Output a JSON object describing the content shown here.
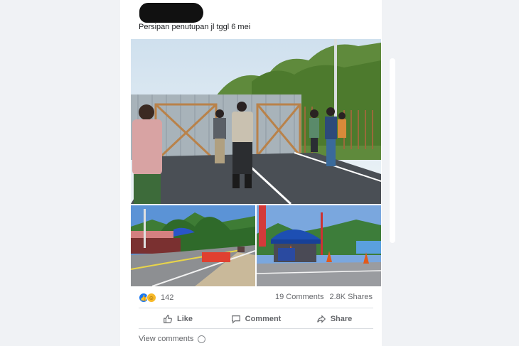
{
  "post": {
    "caption": "Persipan penutupan jl tggl 6 mei"
  },
  "reactions": {
    "icons": [
      "like-icon",
      "haha-icon"
    ],
    "count": "142"
  },
  "stats": {
    "comments": "19 Comments",
    "shares": "2.8K Shares"
  },
  "actions": {
    "like": "Like",
    "comment": "Comment",
    "share": "Share"
  },
  "footer": {
    "view_comments": "View comments"
  },
  "colors": {
    "background": "#f0f2f5",
    "card": "#ffffff",
    "accent": "#1877f2",
    "text_secondary": "#65676b"
  }
}
